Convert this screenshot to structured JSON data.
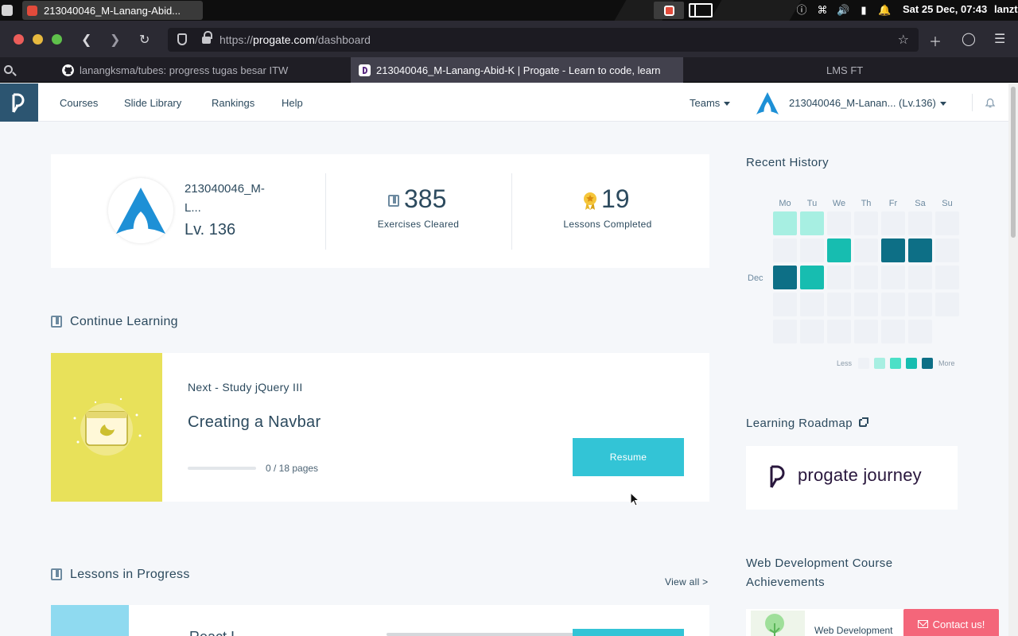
{
  "os": {
    "window_title": "213040046_M-Lanang-Abid...",
    "clock": "Sat 25 Dec, 07:43",
    "user": "lanzt"
  },
  "browser": {
    "url_prefix": "https://",
    "url_host": "progate.com",
    "url_path": "/dashboard",
    "tabs": [
      {
        "label": "lanangksma/tubes: progress tugas besar ITW",
        "icon": "github-icon"
      },
      {
        "label": "213040046_M-Lanang-Abid-K | Progate - Learn to code, learn",
        "icon": "progate-icon",
        "active": true
      },
      {
        "label": "LMS FT",
        "icon": "none"
      }
    ]
  },
  "nav": {
    "links": [
      "Courses",
      "Slide Library",
      "Rankings",
      "Help"
    ],
    "teams": "Teams",
    "username": "213040046_M-Lanan... (Lv.136)"
  },
  "profile": {
    "name": "213040046_M-L...",
    "level": "Lv. 136",
    "exercises_value": "385",
    "exercises_label": "Exercises Cleared",
    "lessons_value": "19",
    "lessons_label": "Lessons Completed"
  },
  "continue": {
    "section_title": "Continue Learning",
    "next": "Next - Study jQuery III",
    "lesson_title": "Creating a Navbar",
    "progress_text": "0 / 18 pages",
    "progress_fraction": 0,
    "button": "Resume"
  },
  "in_progress": {
    "section_title": "Lessons in Progress",
    "view_all": "View all >",
    "first_title": "React I"
  },
  "history": {
    "title": "Recent History",
    "days": [
      "Mo",
      "Tu",
      "We",
      "Th",
      "Fr",
      "Sa",
      "Su"
    ],
    "month_label": "Dec",
    "levels": [
      [
        1,
        1,
        0,
        0,
        0,
        0,
        0
      ],
      [
        0,
        0,
        3,
        0,
        4,
        4,
        0
      ],
      [
        4,
        3,
        0,
        0,
        0,
        0,
        0
      ],
      [
        0,
        0,
        0,
        0,
        0,
        0,
        0
      ],
      [
        0,
        0,
        0,
        0,
        0,
        0,
        -1
      ]
    ],
    "legend_less": "Less",
    "legend_more": "More",
    "colors": [
      "#eef1f6",
      "#a7efe2",
      "#4be0c7",
      "#17bdb0",
      "#0d6f86"
    ]
  },
  "roadmap": {
    "title": "Learning Roadmap",
    "logo_text": "progate journey"
  },
  "achievements": {
    "title": "Web Development Course Achievements",
    "item": "Web Development"
  },
  "contact": {
    "label": "Contact us!"
  }
}
